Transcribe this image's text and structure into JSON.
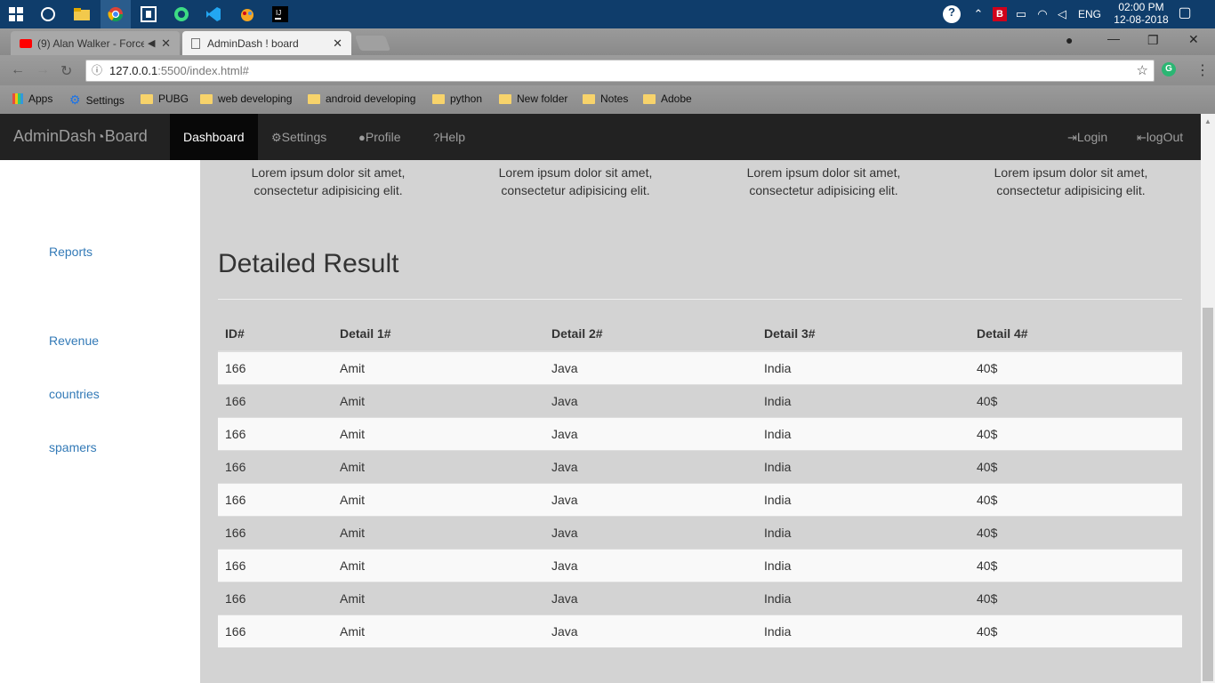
{
  "taskbar": {
    "time": "02:00 PM",
    "date": "12-08-2018",
    "lang": "ENG",
    "icons": [
      "windows-icon",
      "cortana-icon",
      "file-explorer-icon",
      "chrome-icon",
      "app-icon",
      "android-icon",
      "vscode-icon",
      "paint-icon",
      "intellij-icon"
    ]
  },
  "browser": {
    "tabs": [
      {
        "label": "(9) Alan Walker - Force"
      },
      {
        "label": "AdminDash ! board"
      }
    ],
    "url_host": "127.0.0.1",
    "url_path": ":5500/index.html#",
    "bookmarks": [
      {
        "label": "Apps"
      },
      {
        "label": "Settings"
      },
      {
        "label": "PUBG"
      },
      {
        "label": "web developing"
      },
      {
        "label": "android developing"
      },
      {
        "label": "python"
      },
      {
        "label": "New folder"
      },
      {
        "label": "Notes"
      },
      {
        "label": "Adobe"
      }
    ]
  },
  "navbar": {
    "brand_left": "AdminDash",
    "brand_right": "Board",
    "items": [
      {
        "label": "Dashboard"
      },
      {
        "label": "Settings"
      },
      {
        "label": "Profile"
      },
      {
        "label": "Help"
      }
    ],
    "right": [
      {
        "label": "Login"
      },
      {
        "label": "logOut"
      }
    ]
  },
  "sidebar": {
    "items": [
      {
        "label": "Reports"
      },
      {
        "label": "Revenue"
      },
      {
        "label": "countries"
      },
      {
        "label": "spamers"
      }
    ]
  },
  "main": {
    "lorem": [
      {
        "line1": "Lorem ipsum dolor sit amet,",
        "line2": "consectetur adipisicing elit."
      },
      {
        "line1": "Lorem ipsum dolor sit amet,",
        "line2": "consectetur adipisicing elit."
      },
      {
        "line1": "Lorem ipsum dolor sit amet,",
        "line2": "consectetur adipisicing elit."
      },
      {
        "line1": "Lorem ipsum dolor sit amet,",
        "line2": "consectetur adipisicing elit."
      }
    ],
    "title": "Detailed Result",
    "table": {
      "headers": [
        "ID#",
        "Detail 1#",
        "Detail 2#",
        "Detail 3#",
        "Detail 4#"
      ],
      "rows": [
        [
          "166",
          "Amit",
          "Java",
          "India",
          "40$"
        ],
        [
          "166",
          "Amit",
          "Java",
          "India",
          "40$"
        ],
        [
          "166",
          "Amit",
          "Java",
          "India",
          "40$"
        ],
        [
          "166",
          "Amit",
          "Java",
          "India",
          "40$"
        ],
        [
          "166",
          "Amit",
          "Java",
          "India",
          "40$"
        ],
        [
          "166",
          "Amit",
          "Java",
          "India",
          "40$"
        ],
        [
          "166",
          "Amit",
          "Java",
          "India",
          "40$"
        ],
        [
          "166",
          "Amit",
          "Java",
          "India",
          "40$"
        ],
        [
          "166",
          "Amit",
          "Java",
          "India",
          "40$"
        ]
      ]
    }
  },
  "colors": {
    "navbar_bg": "#222222",
    "link": "#337ab7",
    "page_bg": "#d3d3d3"
  }
}
